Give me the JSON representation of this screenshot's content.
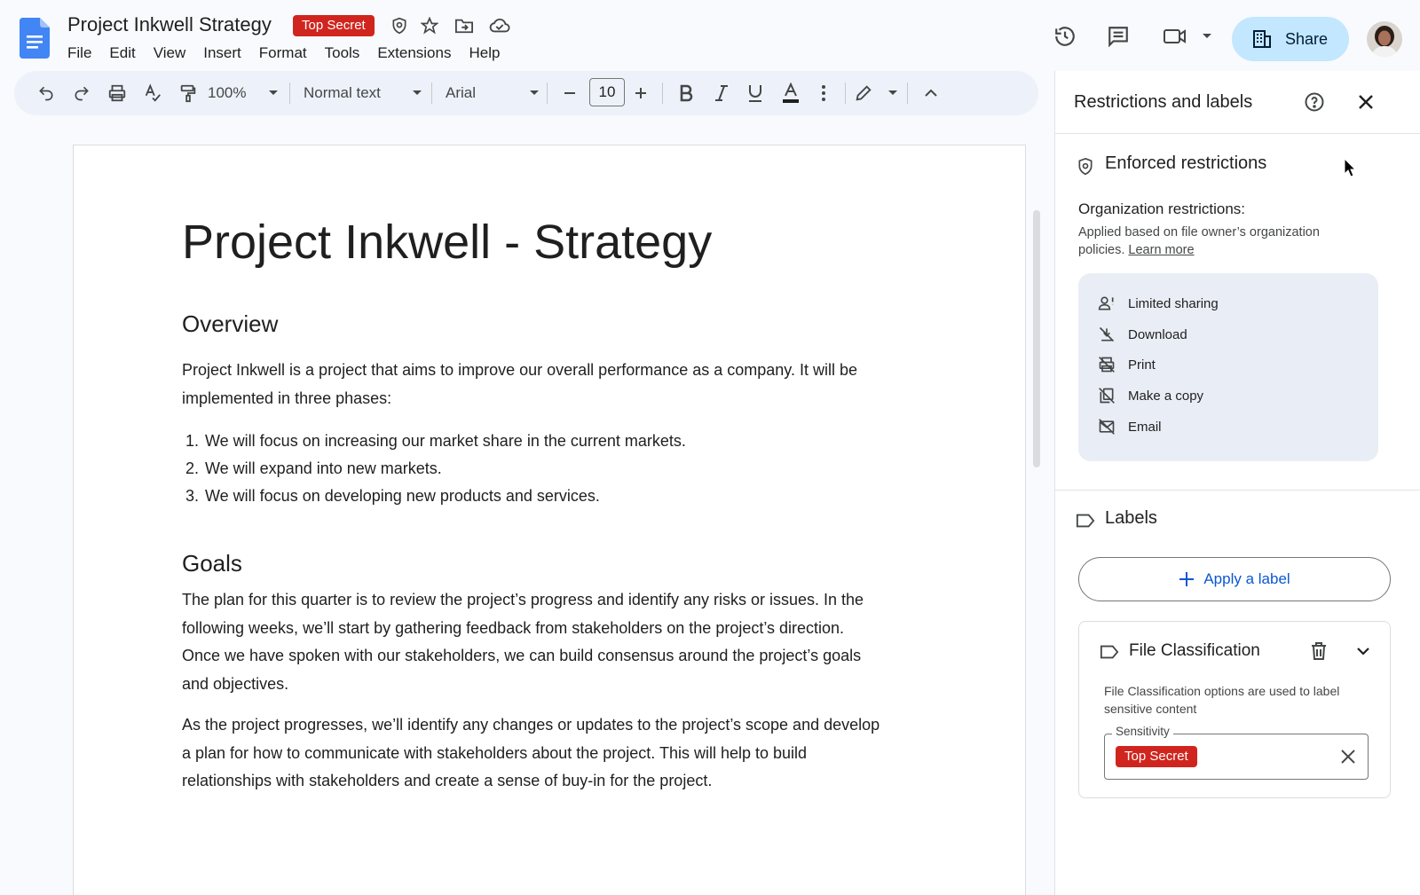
{
  "app": {
    "doc_title": "Project Inkwell Strategy",
    "classification_badge": "Top Secret",
    "share_label": "Share"
  },
  "menu": [
    "File",
    "Edit",
    "View",
    "Insert",
    "Format",
    "Tools",
    "Extensions",
    "Help"
  ],
  "toolbar": {
    "zoom": "100%",
    "style": "Normal text",
    "font": "Arial",
    "font_size": "10"
  },
  "document": {
    "title": "Project Inkwell - Strategy",
    "overview_heading": "Overview",
    "overview_paragraph": "Project Inkwell is a project that aims to improve our overall performance as a company. It will be implemented in three phases:",
    "list": [
      {
        "num": "1.",
        "text": "We will focus on increasing our market share in the current markets."
      },
      {
        "num": "2.",
        "text": "We will expand into new markets."
      },
      {
        "num": "3.",
        "text": "We will focus on developing new products and services."
      }
    ],
    "goals_heading": "Goals",
    "goals_paragraph": "The plan for this quarter is to review the project’s progress and identify any risks or issues. In the following weeks, we’ll start by gathering feedback from stakeholders on the project’s direction. Once we have spoken with our stakeholders, we can build consensus around the project’s goals and objectives.",
    "closing_paragraph": "As the project progresses, we’ll identify any changes or updates to the project’s scope and develop a plan for how to communicate with stakeholders about the project. This will help to build relationships with stakeholders and create a sense of buy-in for the project."
  },
  "side_panel": {
    "title": "Restrictions and labels",
    "enforced_title": "Enforced restrictions",
    "org_title": "Organization restrictions:",
    "org_desc": "Applied based on file owner’s organization policies.",
    "learn_more": "Learn more",
    "restrictions": [
      {
        "label": "Limited sharing",
        "icon": "limited-sharing-icon"
      },
      {
        "label": "Download",
        "icon": "download-off-icon"
      },
      {
        "label": "Print",
        "icon": "print-off-icon"
      },
      {
        "label": "Make a copy",
        "icon": "copy-off-icon"
      },
      {
        "label": "Email",
        "icon": "email-off-icon"
      }
    ],
    "labels_title": "Labels",
    "apply_label": "Apply a label",
    "file_classification": {
      "title": "File Classification",
      "desc": "File Classification options are used to label sensitive content",
      "field_label": "Sensitivity",
      "value": "Top Secret"
    }
  },
  "colors": {
    "badge_red": "#d0251e",
    "share_bg": "#c2e7ff",
    "toolbar_bg": "#edf2fa",
    "link_blue": "#0b57d0"
  }
}
